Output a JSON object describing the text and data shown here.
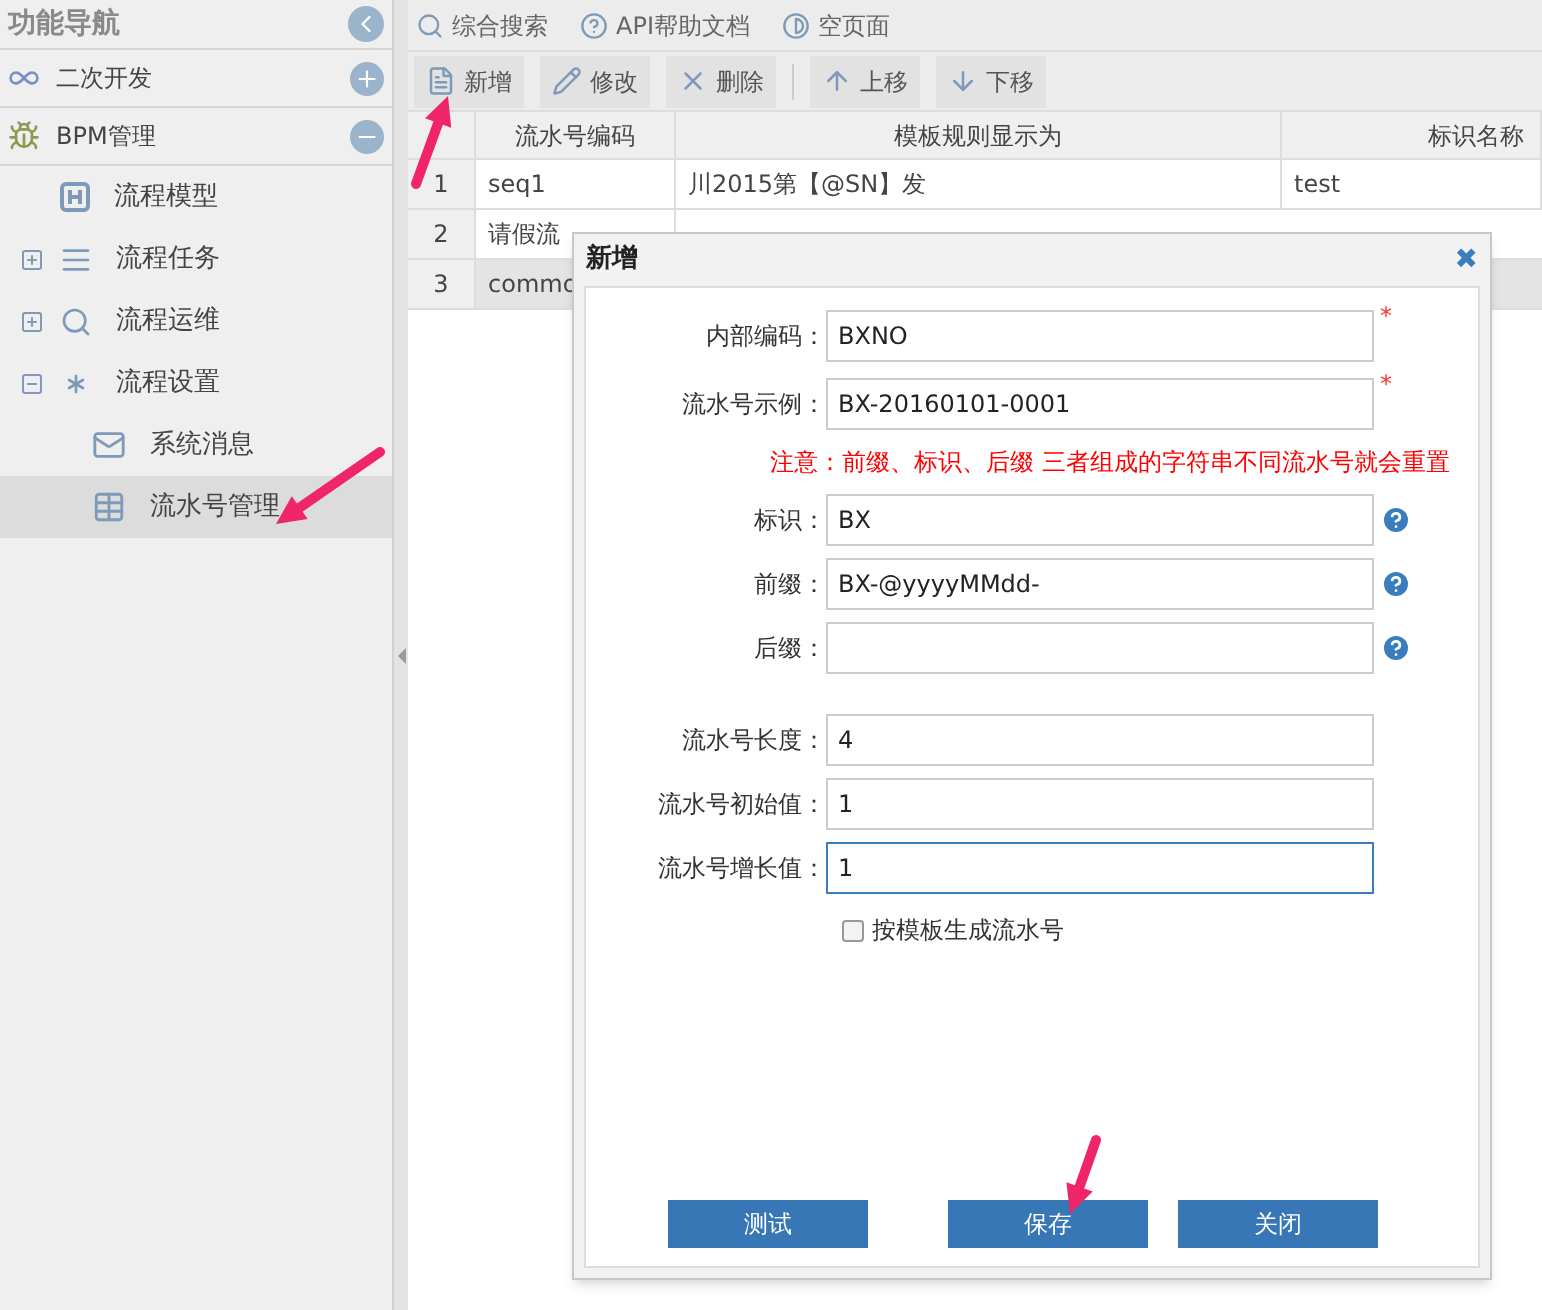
{
  "sidebar": {
    "title": "功能导航",
    "sections": [
      {
        "label": "二次开发",
        "expanded": false
      },
      {
        "label": "BPM管理",
        "expanded": true,
        "children": [
          {
            "label": "流程模型",
            "selected": false
          },
          {
            "label": "流程任务",
            "expanded": false,
            "selected": false
          },
          {
            "label": "流程运维",
            "expanded": false,
            "selected": false
          },
          {
            "label": "流程设置",
            "expanded": true,
            "selected": false,
            "children": [
              {
                "label": "系统消息",
                "selected": false
              },
              {
                "label": "流水号管理",
                "selected": true
              }
            ]
          }
        ]
      }
    ]
  },
  "top_links": [
    "综合搜索",
    "API帮助文档",
    "空页面"
  ],
  "toolbar": [
    {
      "kind": "button",
      "label": "新增"
    },
    {
      "kind": "button",
      "label": "修改"
    },
    {
      "kind": "button",
      "label": "删除"
    },
    {
      "kind": "separator"
    },
    {
      "kind": "button",
      "label": "上移"
    },
    {
      "kind": "button",
      "label": "下移"
    }
  ],
  "table": {
    "columns": [
      "流水号编码",
      "模板规则显示为",
      "标识名称"
    ],
    "rows": [
      {
        "index": "1",
        "cells": [
          "seq1",
          "川2015第【@SN】发",
          "test"
        ],
        "selected": false
      },
      {
        "index": "2",
        "cells": [
          "请假流"
        ],
        "selected": false
      },
      {
        "index": "3",
        "cells": [
          "commo"
        ],
        "selected": true
      }
    ]
  },
  "dialog": {
    "title": "新增",
    "close": "✖",
    "groups": [
      [
        {
          "label": "内部编码：",
          "value": "BXNO",
          "required_mark": "*",
          "help": false,
          "focused": false
        },
        {
          "label": "流水号示例：",
          "value": "BX-20160101-0001",
          "required_mark": "*",
          "help": false,
          "focused": false
        }
      ],
      [
        {
          "label": "标识：",
          "value": "BX",
          "help": true,
          "focused": false
        },
        {
          "label": "前缀：",
          "value": "BX-@yyyyMMdd-",
          "help": true,
          "focused": false
        },
        {
          "label": "后缀：",
          "help": true,
          "focused": false
        }
      ],
      [
        {
          "label": "流水号长度：",
          "value": "4",
          "help": false,
          "focused": false
        },
        {
          "label": "流水号初始值：",
          "value": "1",
          "help": false,
          "focused": false
        },
        {
          "label": "流水号增长值：",
          "value": "1",
          "help": false,
          "focused": true
        }
      ]
    ],
    "note": "注意：前缀、标识、后缀  三者组成的字符串不同流水号就会重置",
    "checkbox": {
      "label": "按模板生成流水号",
      "checked": false
    },
    "buttons": [
      "测试",
      "保存",
      "关闭"
    ]
  }
}
